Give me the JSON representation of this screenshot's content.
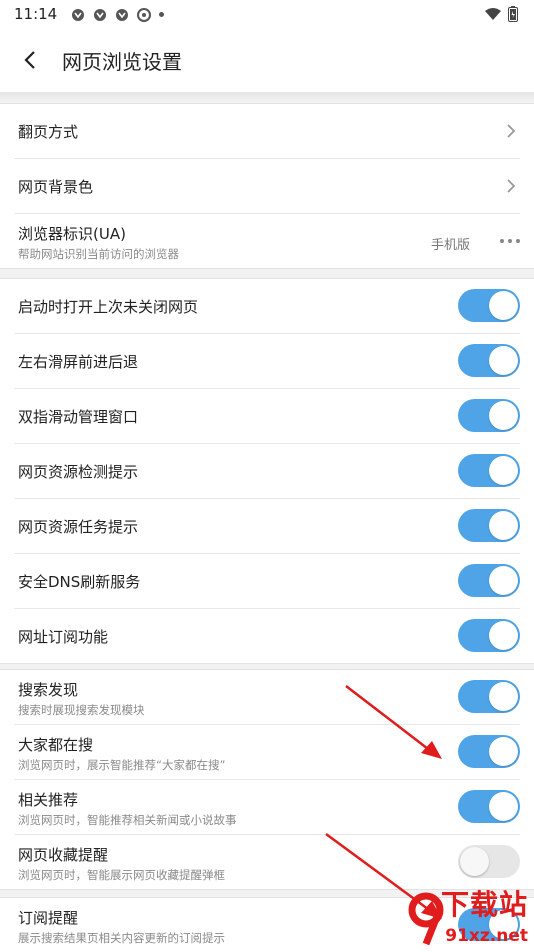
{
  "status_bar": {
    "time": "11:14"
  },
  "header": {
    "title": "网页浏览设置"
  },
  "group1": [
    {
      "label": "翻页方式"
    },
    {
      "label": "网页背景色"
    },
    {
      "label": "浏览器标识(UA)",
      "subtitle": "帮助网站识别当前访问的浏览器",
      "value": "手机版"
    }
  ],
  "group2": [
    {
      "label": "启动时打开上次未关闭网页",
      "on": true
    },
    {
      "label": "左右滑屏前进后退",
      "on": true
    },
    {
      "label": "双指滑动管理窗口",
      "on": true
    },
    {
      "label": "网页资源检测提示",
      "on": true
    },
    {
      "label": "网页资源任务提示",
      "on": true
    },
    {
      "label": "安全DNS刷新服务",
      "on": true
    },
    {
      "label": "网址订阅功能",
      "on": true
    }
  ],
  "group3": [
    {
      "label": "搜索发现",
      "subtitle": "搜索时展现搜索发现模块",
      "on": true
    },
    {
      "label": "大家都在搜",
      "subtitle": "浏览网页时，展示智能推荐“大家都在搜”",
      "on": true
    },
    {
      "label": "相关推荐",
      "subtitle": "浏览网页时，智能推荐相关新闻或小说故事",
      "on": true
    },
    {
      "label": "网页收藏提醒",
      "subtitle": "浏览网页时，智能展示网页收藏提醒弹框",
      "on": false
    }
  ],
  "group4": [
    {
      "label": "订阅提醒",
      "subtitle": "展示搜索结果页相关内容更新的订阅提示"
    }
  ],
  "colors": {
    "toggle_on": "#4ea4e6",
    "toggle_off": "#e6e6e6",
    "annotation_arrow": "#e01c1c"
  },
  "watermark": {
    "line1": "下载站",
    "line2": "91xz.net"
  }
}
